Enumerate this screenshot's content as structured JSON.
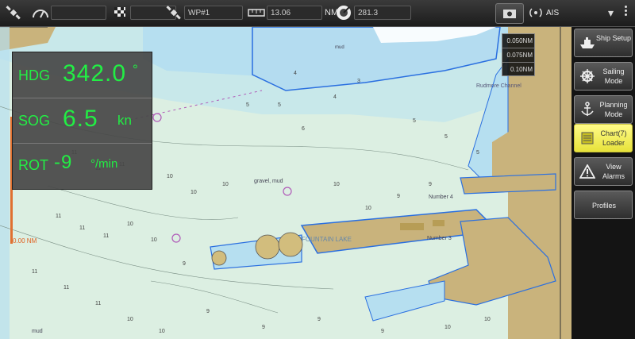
{
  "topbar": {
    "gps_icon": "satellite-icon",
    "speed_icon_label": "SPEED",
    "speed_value": "",
    "finish_icon": "checkered-flag-icon",
    "finish_value": "",
    "waypoint_icon": "satellite-icon",
    "waypoint_value": "WP#1",
    "distance_value": "13.06",
    "distance_unit": "NM",
    "bearing_value": "281.3",
    "ais_label": "AIS",
    "menu_icon": "chevron-down-icon"
  },
  "nav": {
    "hdg_label": "HDG",
    "hdg_value": "342.0",
    "hdg_unit": "°",
    "sog_label": "SOG",
    "sog_value": "6.5",
    "sog_unit": "kn",
    "rot_label": "ROT",
    "rot_value": "-9",
    "rot_unit": "°/min"
  },
  "scale": [
    "0.050NM",
    "0.075NM",
    "0.10NM"
  ],
  "ruler_label": "0.00 NM",
  "chart_labels": {
    "fountain_lake": "FOUNTAIN LAKE",
    "number4": "Number 4",
    "number3": "Number 3",
    "gravel_mud": "gravel, mud",
    "mud": "mud",
    "mud2": "mud",
    "rudmore": "Rudmore Channel"
  },
  "sidebar": {
    "items": [
      {
        "label": "Ship Setup",
        "icon": "ship-icon"
      },
      {
        "label": "Sailing Mode",
        "icon": "helm-icon"
      },
      {
        "label": "Planning Mode",
        "icon": "anchor-icon"
      },
      {
        "label": "Chart(7) Loader",
        "icon": "chart-loader-icon",
        "active": true
      },
      {
        "label": "View Alarms",
        "icon": "warning-icon"
      },
      {
        "label": "Profiles",
        "icon": ""
      }
    ]
  },
  "colors": {
    "accent_green": "#22ee44",
    "active_button": "#eeea55",
    "shallow_water": "#b9e0ef",
    "land": "#c9b37c"
  }
}
